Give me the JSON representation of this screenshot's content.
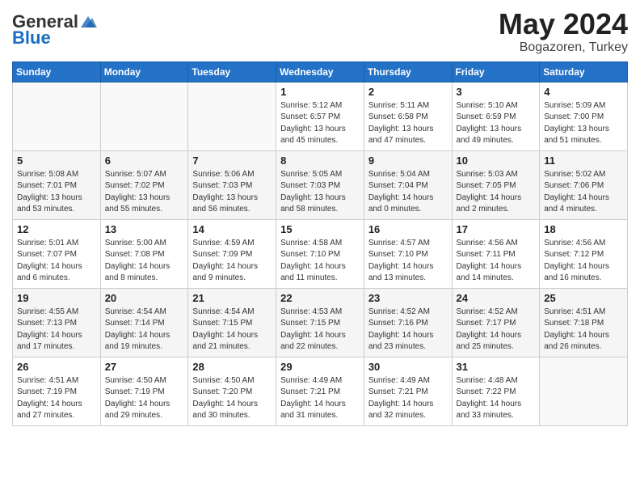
{
  "header": {
    "logo_general": "General",
    "logo_blue": "Blue",
    "title": "May 2024",
    "location": "Bogazoren, Turkey"
  },
  "days_of_week": [
    "Sunday",
    "Monday",
    "Tuesday",
    "Wednesday",
    "Thursday",
    "Friday",
    "Saturday"
  ],
  "weeks": [
    [
      {
        "day": "",
        "info": ""
      },
      {
        "day": "",
        "info": ""
      },
      {
        "day": "",
        "info": ""
      },
      {
        "day": "1",
        "info": "Sunrise: 5:12 AM\nSunset: 6:57 PM\nDaylight: 13 hours\nand 45 minutes."
      },
      {
        "day": "2",
        "info": "Sunrise: 5:11 AM\nSunset: 6:58 PM\nDaylight: 13 hours\nand 47 minutes."
      },
      {
        "day": "3",
        "info": "Sunrise: 5:10 AM\nSunset: 6:59 PM\nDaylight: 13 hours\nand 49 minutes."
      },
      {
        "day": "4",
        "info": "Sunrise: 5:09 AM\nSunset: 7:00 PM\nDaylight: 13 hours\nand 51 minutes."
      }
    ],
    [
      {
        "day": "5",
        "info": "Sunrise: 5:08 AM\nSunset: 7:01 PM\nDaylight: 13 hours\nand 53 minutes."
      },
      {
        "day": "6",
        "info": "Sunrise: 5:07 AM\nSunset: 7:02 PM\nDaylight: 13 hours\nand 55 minutes."
      },
      {
        "day": "7",
        "info": "Sunrise: 5:06 AM\nSunset: 7:03 PM\nDaylight: 13 hours\nand 56 minutes."
      },
      {
        "day": "8",
        "info": "Sunrise: 5:05 AM\nSunset: 7:03 PM\nDaylight: 13 hours\nand 58 minutes."
      },
      {
        "day": "9",
        "info": "Sunrise: 5:04 AM\nSunset: 7:04 PM\nDaylight: 14 hours\nand 0 minutes."
      },
      {
        "day": "10",
        "info": "Sunrise: 5:03 AM\nSunset: 7:05 PM\nDaylight: 14 hours\nand 2 minutes."
      },
      {
        "day": "11",
        "info": "Sunrise: 5:02 AM\nSunset: 7:06 PM\nDaylight: 14 hours\nand 4 minutes."
      }
    ],
    [
      {
        "day": "12",
        "info": "Sunrise: 5:01 AM\nSunset: 7:07 PM\nDaylight: 14 hours\nand 6 minutes."
      },
      {
        "day": "13",
        "info": "Sunrise: 5:00 AM\nSunset: 7:08 PM\nDaylight: 14 hours\nand 8 minutes."
      },
      {
        "day": "14",
        "info": "Sunrise: 4:59 AM\nSunset: 7:09 PM\nDaylight: 14 hours\nand 9 minutes."
      },
      {
        "day": "15",
        "info": "Sunrise: 4:58 AM\nSunset: 7:10 PM\nDaylight: 14 hours\nand 11 minutes."
      },
      {
        "day": "16",
        "info": "Sunrise: 4:57 AM\nSunset: 7:10 PM\nDaylight: 14 hours\nand 13 minutes."
      },
      {
        "day": "17",
        "info": "Sunrise: 4:56 AM\nSunset: 7:11 PM\nDaylight: 14 hours\nand 14 minutes."
      },
      {
        "day": "18",
        "info": "Sunrise: 4:56 AM\nSunset: 7:12 PM\nDaylight: 14 hours\nand 16 minutes."
      }
    ],
    [
      {
        "day": "19",
        "info": "Sunrise: 4:55 AM\nSunset: 7:13 PM\nDaylight: 14 hours\nand 17 minutes."
      },
      {
        "day": "20",
        "info": "Sunrise: 4:54 AM\nSunset: 7:14 PM\nDaylight: 14 hours\nand 19 minutes."
      },
      {
        "day": "21",
        "info": "Sunrise: 4:54 AM\nSunset: 7:15 PM\nDaylight: 14 hours\nand 21 minutes."
      },
      {
        "day": "22",
        "info": "Sunrise: 4:53 AM\nSunset: 7:15 PM\nDaylight: 14 hours\nand 22 minutes."
      },
      {
        "day": "23",
        "info": "Sunrise: 4:52 AM\nSunset: 7:16 PM\nDaylight: 14 hours\nand 23 minutes."
      },
      {
        "day": "24",
        "info": "Sunrise: 4:52 AM\nSunset: 7:17 PM\nDaylight: 14 hours\nand 25 minutes."
      },
      {
        "day": "25",
        "info": "Sunrise: 4:51 AM\nSunset: 7:18 PM\nDaylight: 14 hours\nand 26 minutes."
      }
    ],
    [
      {
        "day": "26",
        "info": "Sunrise: 4:51 AM\nSunset: 7:19 PM\nDaylight: 14 hours\nand 27 minutes."
      },
      {
        "day": "27",
        "info": "Sunrise: 4:50 AM\nSunset: 7:19 PM\nDaylight: 14 hours\nand 29 minutes."
      },
      {
        "day": "28",
        "info": "Sunrise: 4:50 AM\nSunset: 7:20 PM\nDaylight: 14 hours\nand 30 minutes."
      },
      {
        "day": "29",
        "info": "Sunrise: 4:49 AM\nSunset: 7:21 PM\nDaylight: 14 hours\nand 31 minutes."
      },
      {
        "day": "30",
        "info": "Sunrise: 4:49 AM\nSunset: 7:21 PM\nDaylight: 14 hours\nand 32 minutes."
      },
      {
        "day": "31",
        "info": "Sunrise: 4:48 AM\nSunset: 7:22 PM\nDaylight: 14 hours\nand 33 minutes."
      },
      {
        "day": "",
        "info": ""
      }
    ]
  ]
}
